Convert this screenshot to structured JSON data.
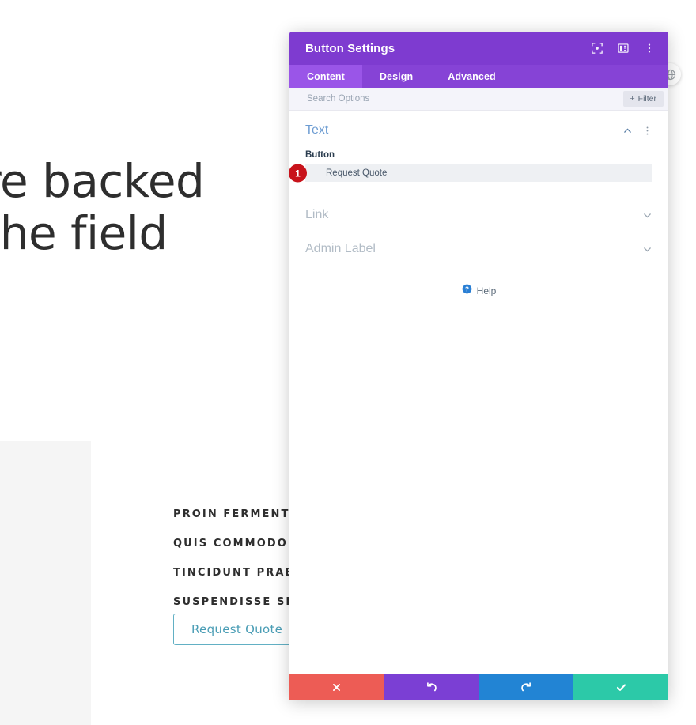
{
  "background": {
    "heading_lines": [
      "es are backed",
      "s in the field"
    ],
    "features": [
      "PROIN FERMENTUM",
      "QUIS COMMODO OD",
      "TINCIDUNT PRAESE",
      "SUSPENDISSE SED"
    ],
    "quote_button_label": "Request Quote",
    "globe_icon_name": "globe-icon"
  },
  "modal": {
    "title": "Button Settings",
    "titlebar_icons": [
      {
        "name": "focus-target-icon"
      },
      {
        "name": "layout-panel-icon"
      },
      {
        "name": "kebab-menu-icon"
      }
    ],
    "tabs": [
      {
        "label": "Content",
        "active": true
      },
      {
        "label": "Design",
        "active": false
      },
      {
        "label": "Advanced",
        "active": false
      }
    ],
    "search": {
      "placeholder": "Search Options",
      "value": ""
    },
    "filter_button_label": "Filter",
    "sections": {
      "text": {
        "title": "Text",
        "expanded": true,
        "collapse_icon": "chevron-up-icon",
        "menu_icon": "kebab-menu-icon",
        "field_label": "Button",
        "field_value": "Request Quote",
        "step_badge": "1"
      },
      "link": {
        "title": "Link",
        "expanded": false,
        "chevron_icon": "chevron-down-icon"
      },
      "admin_label": {
        "title": "Admin Label",
        "expanded": false,
        "chevron_icon": "chevron-down-icon"
      }
    },
    "help": {
      "label": "Help",
      "icon": "help-question-icon"
    },
    "footer_buttons": [
      {
        "name": "cancel-button",
        "icon": "close-x-icon",
        "color": "#ed5c55"
      },
      {
        "name": "undo-button",
        "icon": "undo-arrow-icon",
        "color": "#7b3fd4"
      },
      {
        "name": "redo-button",
        "icon": "redo-arrow-icon",
        "color": "#2284d4"
      },
      {
        "name": "save-button",
        "icon": "check-icon",
        "color": "#2cc9a8"
      }
    ]
  },
  "colors": {
    "titlebar_purple": "#7e3bd0",
    "tabbar_purple": "#8643d6",
    "tab_active_purple": "#9a55e8",
    "section_title_blue": "#6c9cd2",
    "badge_red": "#c8131b",
    "quote_button_teal": "#4a9db5"
  }
}
